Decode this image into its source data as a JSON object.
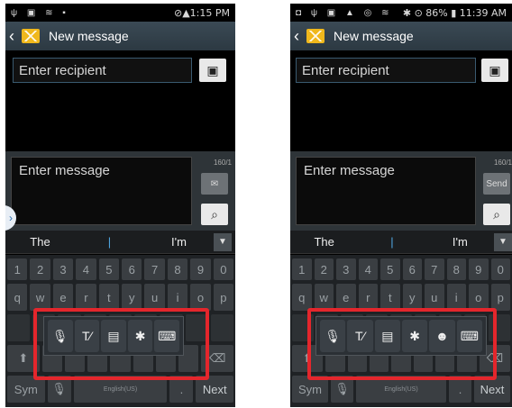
{
  "left": {
    "status_icons": "ψ ▣ ≋ ▪",
    "status_time": "⊘▲1:15 PM",
    "title": "New message",
    "recipient_placeholder": "Enter recipient",
    "message_placeholder": "Enter message",
    "counter": "160/1",
    "suggestions": [
      "The",
      "|",
      "I'm"
    ],
    "number_keys": [
      "1",
      "2",
      "3",
      "4",
      "5",
      "6",
      "7",
      "8",
      "9",
      "0"
    ],
    "q_keys": [
      "q",
      "w",
      "e",
      "r",
      "t",
      "y",
      "u",
      "i",
      "o",
      "p"
    ],
    "sym_label": "Sym",
    "space_label": "English(US)",
    "next_label": "Next",
    "popup_options": [
      "mic-icon",
      "text-style-icon",
      "clipboard-icon",
      "settings-icon",
      "keyboard-icon"
    ]
  },
  "right": {
    "status_icons": "◘ ψ ▣ ▲ ◎ ≋",
    "status_time": "✱ ⊙ 86% ▮ 11:39 AM",
    "title": "New message",
    "recipient_placeholder": "Enter recipient",
    "message_placeholder": "Enter message",
    "counter": "160/1",
    "send_label": "Send",
    "suggestions": [
      "The",
      "|",
      "I'm"
    ],
    "number_keys": [
      "1",
      "2",
      "3",
      "4",
      "5",
      "6",
      "7",
      "8",
      "9",
      "0"
    ],
    "q_keys": [
      "q",
      "w",
      "e",
      "r",
      "t",
      "y",
      "u",
      "i",
      "o",
      "p"
    ],
    "sym_label": "Sym",
    "space_label": "English(US)",
    "next_label": "Next",
    "popup_options": [
      "mic-icon",
      "text-style-icon",
      "clipboard-icon",
      "settings-icon",
      "emoji-icon",
      "keyboard-icon"
    ]
  },
  "colors": {
    "highlight": "#e4262c",
    "actionbar": "#34434e",
    "accent": "#4fa6e0"
  }
}
